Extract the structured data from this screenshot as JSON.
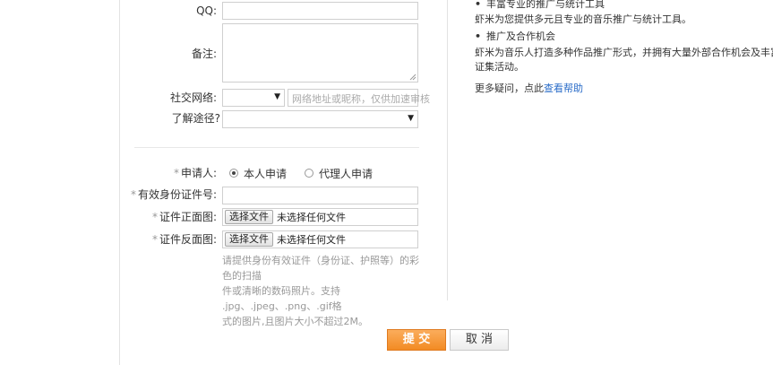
{
  "form": {
    "qq_label": "QQ:",
    "remark_label": "备注:",
    "social_label": "社交网络:",
    "social_placeholder": "网络地址或昵称，仅供加速审核",
    "source_label": "了解途径?",
    "applicant_label": "申请人:",
    "applicant_required": "*",
    "radio_self": "本人申请",
    "radio_agent": "代理人申请",
    "id_label": "有效身份证件号:",
    "id_required": "*",
    "front_label": "证件正面图:",
    "front_required": "*",
    "back_label": "证件反面图:",
    "back_required": "*",
    "choose_file": "选择文件",
    "no_file": "未选择任何文件",
    "hint_lines": [
      "请提供身份有效证件（身份证、护照等）的彩色的扫描",
      "件或清晰的数码照片。支持 .jpg、.jpeg、.png、.gif格",
      "式的图片,且图片大小不超过2M。"
    ]
  },
  "side": {
    "item1_title": "丰富专业的推广与统计工具",
    "item1_desc": "虾米为您提供多元且专业的音乐推广与统计工具。",
    "item2_title": "推广及合作机会",
    "item2_desc_1": "虾米为音乐人打造多种作品推广形式，并拥有大量外部合作机会及丰富多样的",
    "item2_desc_2": "证集活动。",
    "more_prefix": "更多疑问，点此",
    "more_link": "查看帮助",
    "bullet": "•"
  },
  "actions": {
    "submit": "提 交",
    "cancel": "取 消"
  },
  "colors": {
    "accent": "#f28b23",
    "link": "#2a6cc8"
  }
}
